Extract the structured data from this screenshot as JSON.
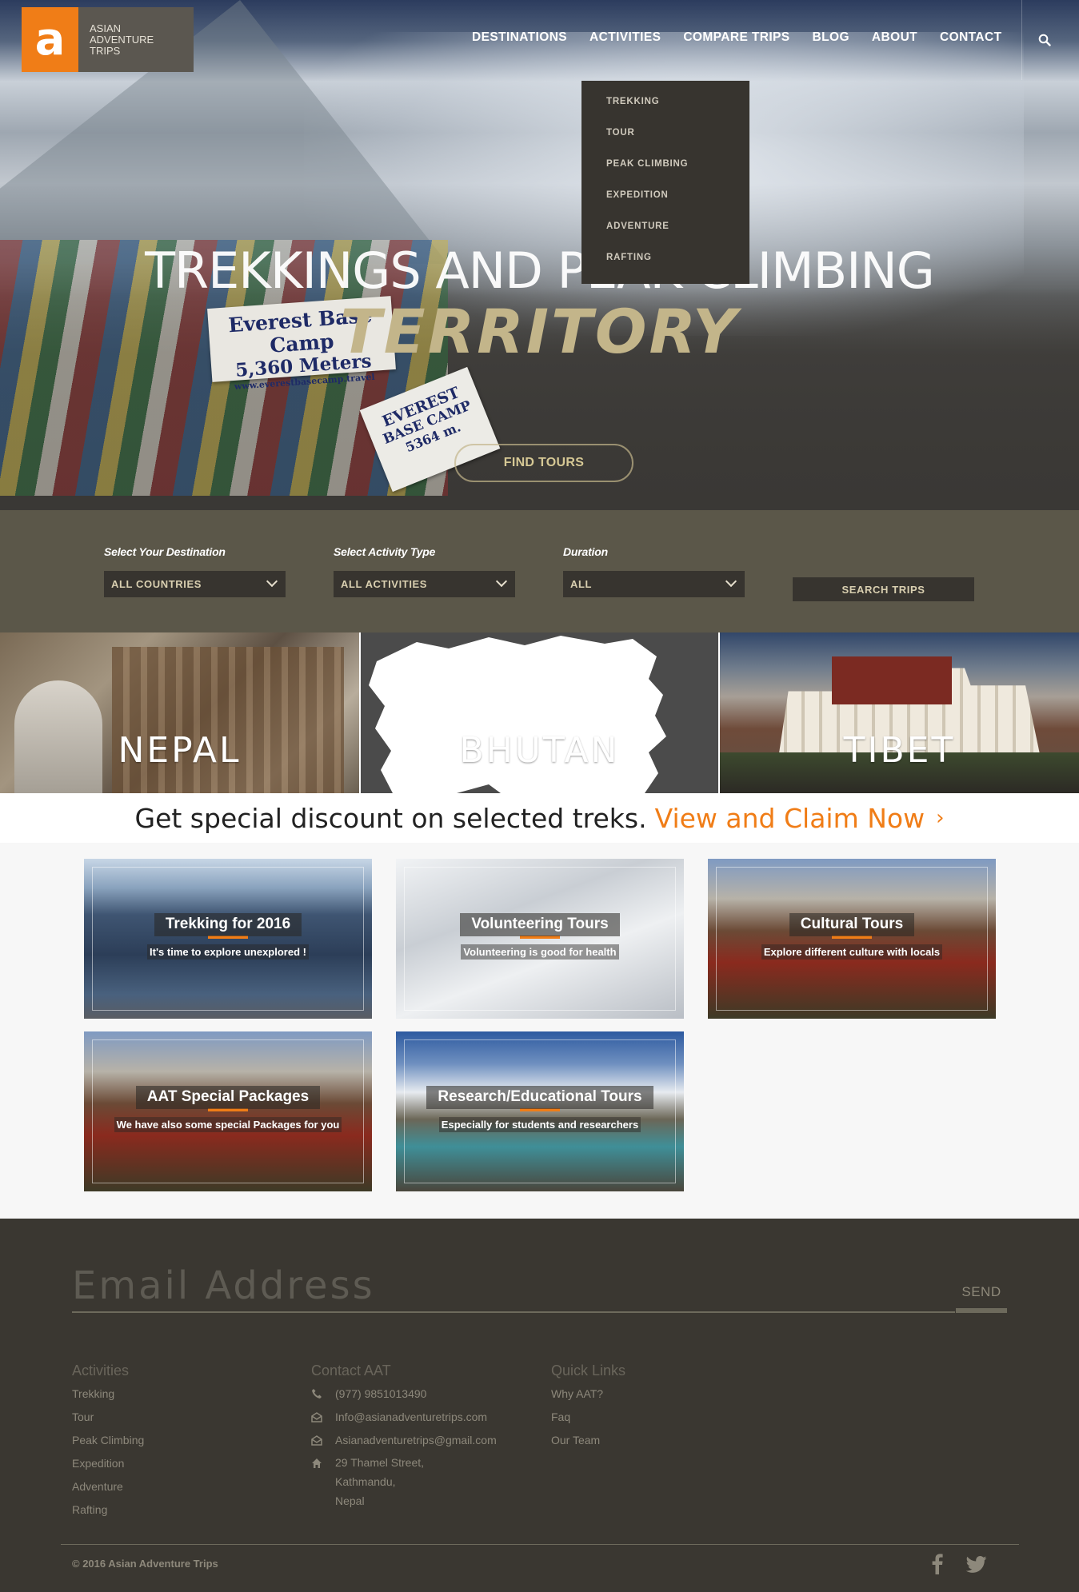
{
  "brand": {
    "line1": "ASIAN",
    "line2": "ADVENTURE",
    "line3": "TRIPS",
    "mark": "a",
    "accent": "#f07d17"
  },
  "nav": {
    "items": [
      "DESTINATIONS",
      "ACTIVITIES",
      "COMPARE TRIPS",
      "BLOG",
      "ABOUT",
      "CONTACT"
    ],
    "search_icon": "search-icon"
  },
  "dropdown": {
    "items": [
      "TREKKING",
      "TOUR",
      "PEAK CLIMBING",
      "EXPEDITION",
      "ADVENTURE",
      "RAFTING"
    ]
  },
  "hero": {
    "headline": "TREKKINGS AND PEAK CLIMBING",
    "subheadline": "TERRITORY",
    "cta": "FIND TOURS",
    "sign1_line1": "Everest Base Camp",
    "sign1_line2": "5,360 Meters",
    "sign1_line3": "www.everestbasecamp.travel",
    "sign2_line1": "EVEREST",
    "sign2_line2": "BASE CAMP",
    "sign2_line3": "5364 m."
  },
  "search": {
    "dest_label": "Select Your Destination",
    "dest_value": "ALL COUNTRIES",
    "activity_label": "Select Activity Type",
    "activity_value": "ALL ACTIVITIES",
    "duration_label": "Duration",
    "duration_value": "ALL",
    "button": "SEARCH TRIPS"
  },
  "countries": [
    "NEPAL",
    "BHUTAN",
    "TIBET"
  ],
  "discount": {
    "text": "Get special discount on selected treks.",
    "link": "View and Claim Now"
  },
  "categories": [
    {
      "title": "Trekking for 2016",
      "subtitle": "It's time to explore unexplored !"
    },
    {
      "title": "Volunteering Tours",
      "subtitle": "Volunteering is good for health"
    },
    {
      "title": "Cultural Tours",
      "subtitle": "Explore different culture with locals"
    },
    {
      "title": "AAT Special Packages",
      "subtitle": "We have also some special Packages for you"
    },
    {
      "title": "Research/Educational Tours",
      "subtitle": "Especially for students and researchers"
    }
  ],
  "newsletter": {
    "placeholder": "Email Address",
    "button": "SEND"
  },
  "footer": {
    "activities": {
      "heading": "Activities",
      "items": [
        "Trekking",
        "Tour",
        "Peak Climbing",
        "Expedition",
        "Adventure",
        "Rafting"
      ]
    },
    "contact": {
      "heading": "Contact AAT",
      "phone": "(977) 9851013490",
      "email1": "Info@asianadventuretrips.com",
      "email2": "Asianadventuretrips@gmail.com",
      "address1": "29 Thamel Street,",
      "address2": "Kathmandu,",
      "address3": "Nepal"
    },
    "links": {
      "heading": "Quick Links",
      "items": [
        "Why AAT?",
        "Faq",
        "Our Team"
      ]
    },
    "copyright": "© 2016 Asian Adventure Trips",
    "social": [
      "facebook-icon",
      "twitter-icon"
    ]
  }
}
